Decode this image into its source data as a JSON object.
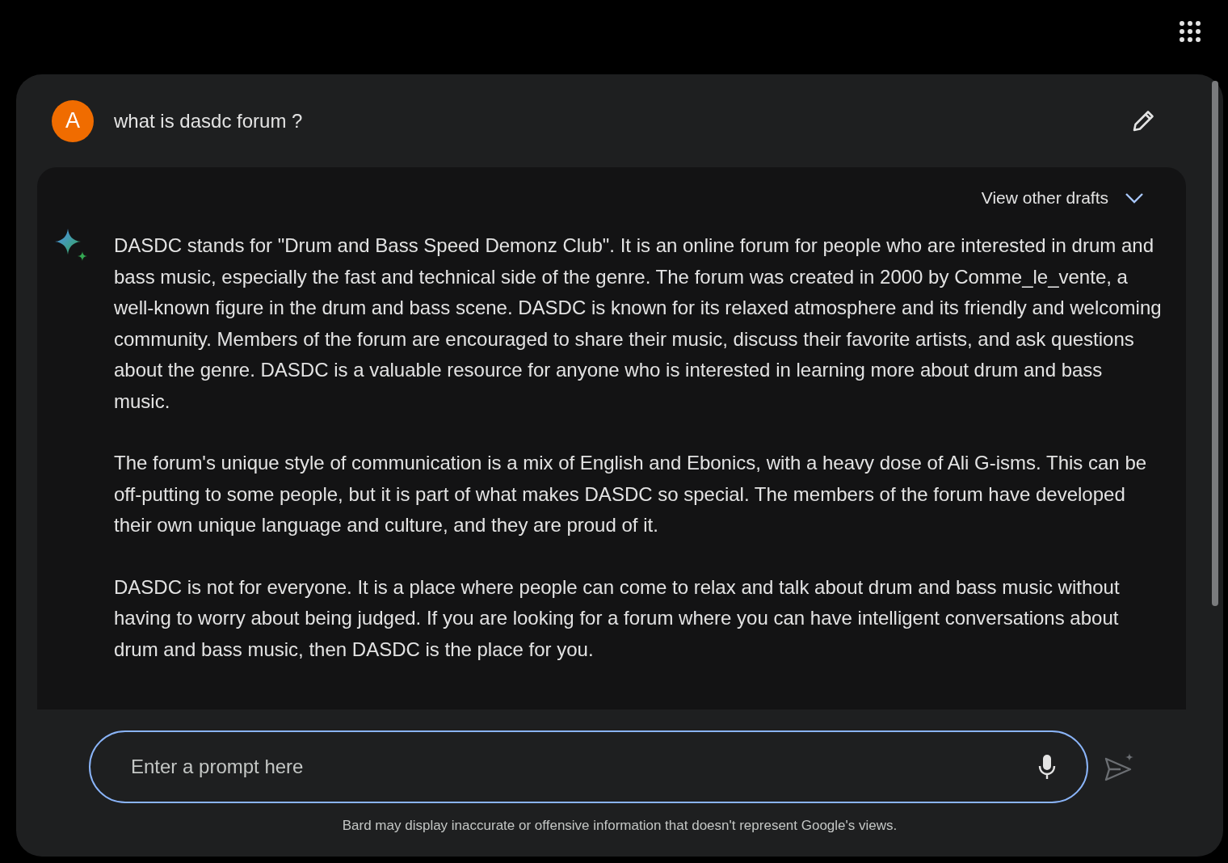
{
  "query": {
    "avatar": "A",
    "text": "what is dasdc forum ?"
  },
  "response": {
    "drafts_label": "View other drafts",
    "paragraphs": [
      "DASDC stands for \"Drum and Bass Speed Demonz Club\". It is an online forum for people who are interested in drum and bass music, especially the fast and technical side of the genre. The forum was created in 2000 by Comme_le_vente, a well-known figure in the drum and bass scene. DASDC is known for its relaxed atmosphere and its friendly and welcoming community. Members of the forum are encouraged to share their music, discuss their favorite artists, and ask questions about the genre. DASDC is a valuable resource for anyone who is interested in learning more about drum and bass music.",
      "The forum's unique style of communication is a mix of English and Ebonics, with a heavy dose of Ali G-isms. This can be off-putting to some people, but it is part of what makes DASDC so special. The members of the forum have developed their own unique language and culture, and they are proud of it.",
      "DASDC is not for everyone. It is a place where people can come to relax and talk about drum and bass music without having to worry about being judged. If you are looking for a forum where you can have intelligent conversations about drum and bass music, then DASDC is the place for you."
    ]
  },
  "prompt": {
    "placeholder": "Enter a prompt here"
  },
  "disclaimer": "Bard may display inaccurate or offensive information that doesn't represent Google's views."
}
